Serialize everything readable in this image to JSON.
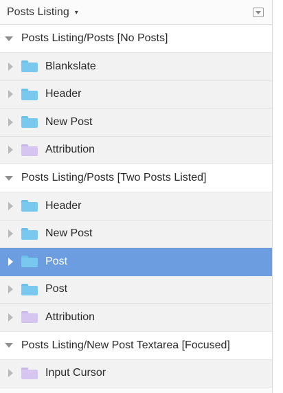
{
  "topbar": {
    "title": "Posts Listing",
    "caret": "▾"
  },
  "groups": [
    {
      "label": "Posts Listing/Posts [No Posts]",
      "items": [
        {
          "label": "Blankslate",
          "folder": "blue"
        },
        {
          "label": "Header",
          "folder": "blue"
        },
        {
          "label": "New Post",
          "folder": "blue"
        },
        {
          "label": "Attribution",
          "folder": "purple"
        }
      ]
    },
    {
      "label": "Posts Listing/Posts [Two Posts Listed]",
      "items": [
        {
          "label": "Header",
          "folder": "blue"
        },
        {
          "label": "New Post",
          "folder": "blue"
        },
        {
          "label": "Post",
          "folder": "blue",
          "selected": true
        },
        {
          "label": "Post",
          "folder": "blue"
        },
        {
          "label": "Attribution",
          "folder": "purple"
        }
      ]
    },
    {
      "label": "Posts Listing/New Post Textarea [Focused]",
      "items": [
        {
          "label": "Input Cursor",
          "folder": "purple"
        }
      ]
    }
  ],
  "colors": {
    "selected_row": "#6c9de0",
    "folder_blue": "#79c8f0",
    "folder_purple": "#d7c5f1"
  }
}
